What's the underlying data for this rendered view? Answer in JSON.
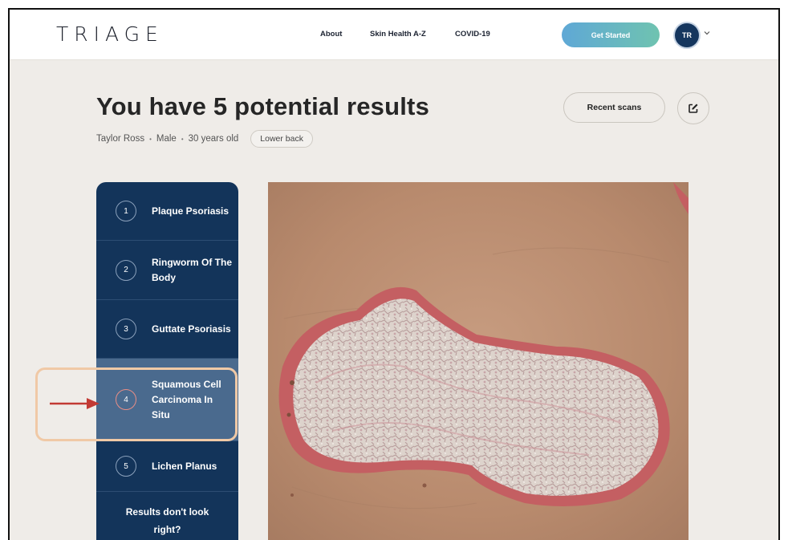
{
  "nav": {
    "logo": "TRIAGE",
    "links": [
      "About",
      "Skin Health A-Z",
      "COVID-19"
    ],
    "cta": "Get Started",
    "avatar_initials": "TR"
  },
  "header": {
    "title": "You have 5 potential results",
    "patient_name": "Taylor Ross",
    "sex": "Male",
    "age": "30 years old",
    "body_location": "Lower back",
    "recent_scans_label": "Recent scans"
  },
  "results": [
    {
      "number": "1",
      "name": "Plaque Psoriasis"
    },
    {
      "number": "2",
      "name": "Ringworm Of The Body"
    },
    {
      "number": "3",
      "name": "Guttate Psoriasis"
    },
    {
      "number": "4",
      "name": "Squamous Cell Carcinoma In Situ",
      "selected": true
    },
    {
      "number": "5",
      "name": "Lichen Planus"
    }
  ],
  "feedback_prompt": "Results don't look right?",
  "icons": {
    "edit": "edit-square-icon",
    "chevron": "chevron-down-icon",
    "annotation": "red-arrow-icon"
  },
  "colors": {
    "sidebar": "#13345a",
    "selected": "#4a6a8e",
    "cta_start": "#5fa8d6",
    "cta_end": "#6fc3b0",
    "highlight": "#f0c9a6",
    "arrow": "#c23a34"
  }
}
